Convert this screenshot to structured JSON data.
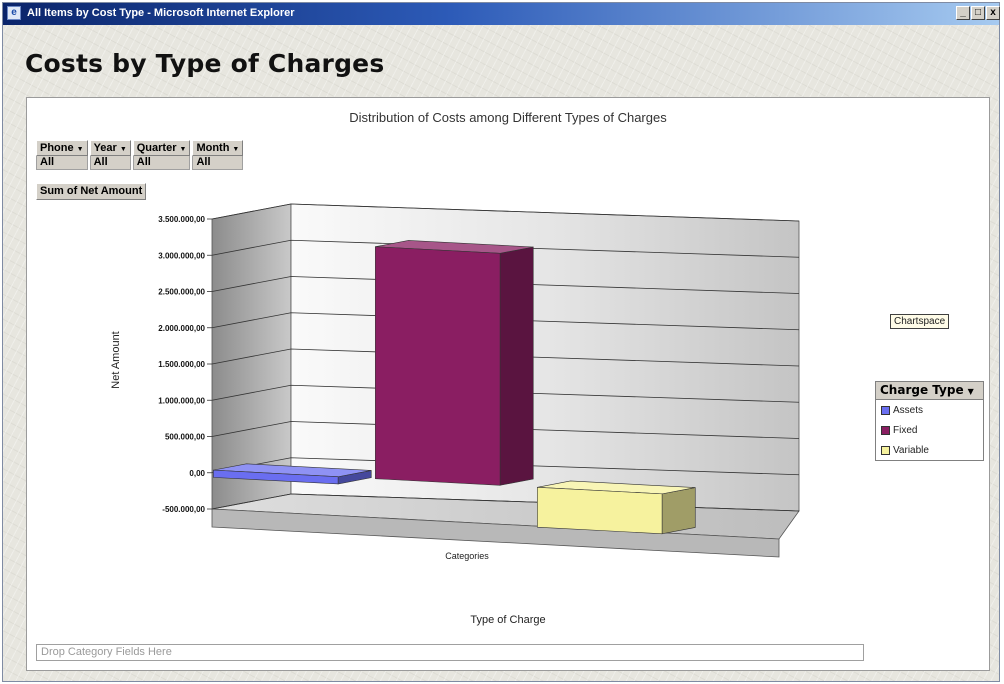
{
  "window": {
    "title": "All Items by Cost Type - Microsoft Internet Explorer",
    "icon": "ie-page-icon",
    "buttons": {
      "minimize": "_",
      "maximize": "□",
      "close": "x"
    }
  },
  "page": {
    "title": "Costs by Type of Charges"
  },
  "filters": [
    {
      "label": "Phone",
      "value": "All"
    },
    {
      "label": "Year",
      "value": "All"
    },
    {
      "label": "Quarter",
      "value": "All"
    },
    {
      "label": "Month",
      "value": "All"
    }
  ],
  "data_field": "Sum of Net Amount",
  "chartspace_label": "Chartspace",
  "legend": {
    "title": "Charge Type",
    "items": [
      {
        "label": "Assets",
        "color": "#6a6ef0"
      },
      {
        "label": "Fixed",
        "color": "#8a1e62"
      },
      {
        "label": "Variable",
        "color": "#f6f29e"
      }
    ]
  },
  "drop_zone_text": "Drop Category Fields Here",
  "chart_data": {
    "type": "bar",
    "title": "Distribution of Costs among Different Types of Charges",
    "xlabel": "Type of Charge",
    "ylabel": "Net Amount",
    "categories": [
      "Categories"
    ],
    "series": [
      {
        "name": "Assets",
        "values": [
          -100000
        ],
        "color": "#6a6ef0"
      },
      {
        "name": "Fixed",
        "values": [
          3200000
        ],
        "color": "#8a1e62"
      },
      {
        "name": "Variable",
        "values": [
          -550000
        ],
        "color": "#f6f29e"
      }
    ],
    "ylim": [
      -500000,
      3500000
    ],
    "yticks": [
      {
        "value": 3500000,
        "label": "3.500.000,00"
      },
      {
        "value": 3000000,
        "label": "3.000.000,00"
      },
      {
        "value": 2500000,
        "label": "2.500.000,00"
      },
      {
        "value": 2000000,
        "label": "2.000.000,00"
      },
      {
        "value": 1500000,
        "label": "1.500.000,00"
      },
      {
        "value": 1000000,
        "label": "1.000.000,00"
      },
      {
        "value": 500000,
        "label": "500.000,00"
      },
      {
        "value": 0,
        "label": "0,00"
      },
      {
        "value": -500000,
        "label": "-500.000,00"
      }
    ],
    "grid": true,
    "three_d": true,
    "legend_position": "right"
  }
}
